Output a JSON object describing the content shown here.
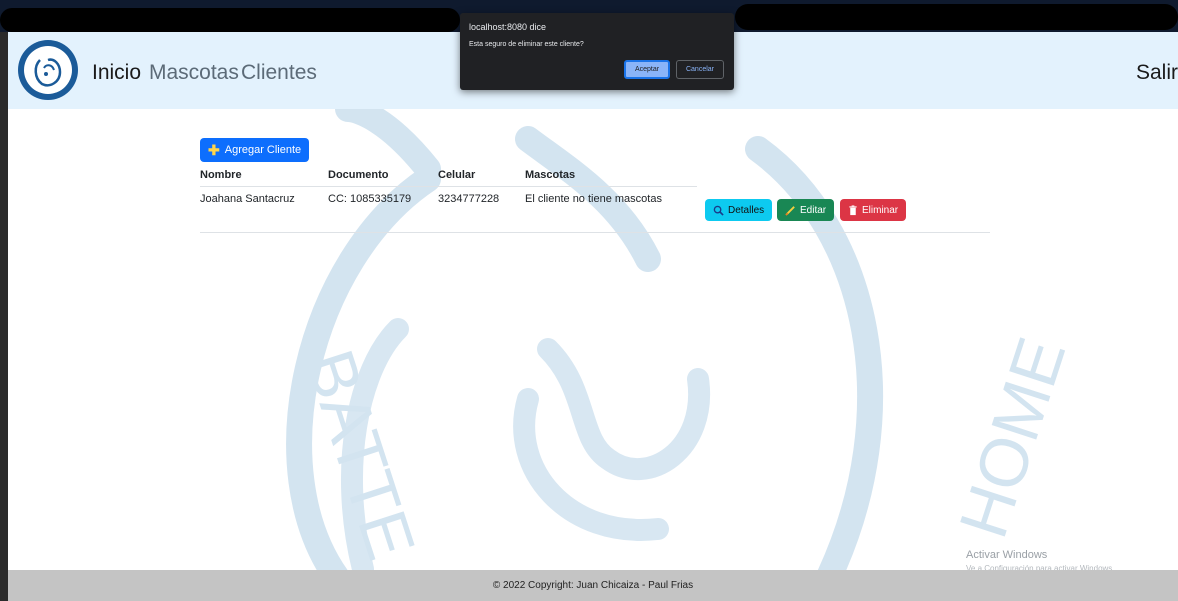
{
  "navbar": {
    "links": {
      "home": "Inicio",
      "pets": "Mascotas",
      "clients": "Clientes"
    },
    "logout": "Salir"
  },
  "content": {
    "add_button": "Agregar Cliente",
    "table": {
      "headers": [
        "Nombre",
        "Documento",
        "Celular",
        "Mascotas"
      ],
      "rows": [
        {
          "name": "Joahana Santacruz",
          "document": "CC: 1085335179",
          "phone": "3234777228",
          "pets": "El cliente no tiene mascotas"
        }
      ]
    },
    "actions": {
      "details": "Detalles",
      "edit": "Editar",
      "delete": "Eliminar"
    }
  },
  "watermark": {
    "text_left": "BATTE",
    "text_right": "HOME"
  },
  "footer": {
    "copyright": "© 2022 Copyright: Juan Chicaiza - Paul Frias"
  },
  "windows_notice": {
    "title": "Activar Windows",
    "subtitle": "Ve a Configuración para activar Windows."
  },
  "dialog": {
    "title": "localhost:8080 dice",
    "message": "Esta seguro de eliminar este cliente?",
    "ok": "Aceptar",
    "cancel": "Cancelar"
  },
  "colors": {
    "navbar_bg": "#e3f2fd",
    "primary": "#0d6efd",
    "info": "#0dcaf0",
    "success": "#198754",
    "danger": "#dc3545",
    "watermark": "#cfe1ee"
  },
  "icons": {
    "logo": "dog-cat-logo-icon",
    "add": "plus-icon",
    "details": "magnifier-icon",
    "edit": "pencil-icon",
    "delete": "trash-icon"
  }
}
